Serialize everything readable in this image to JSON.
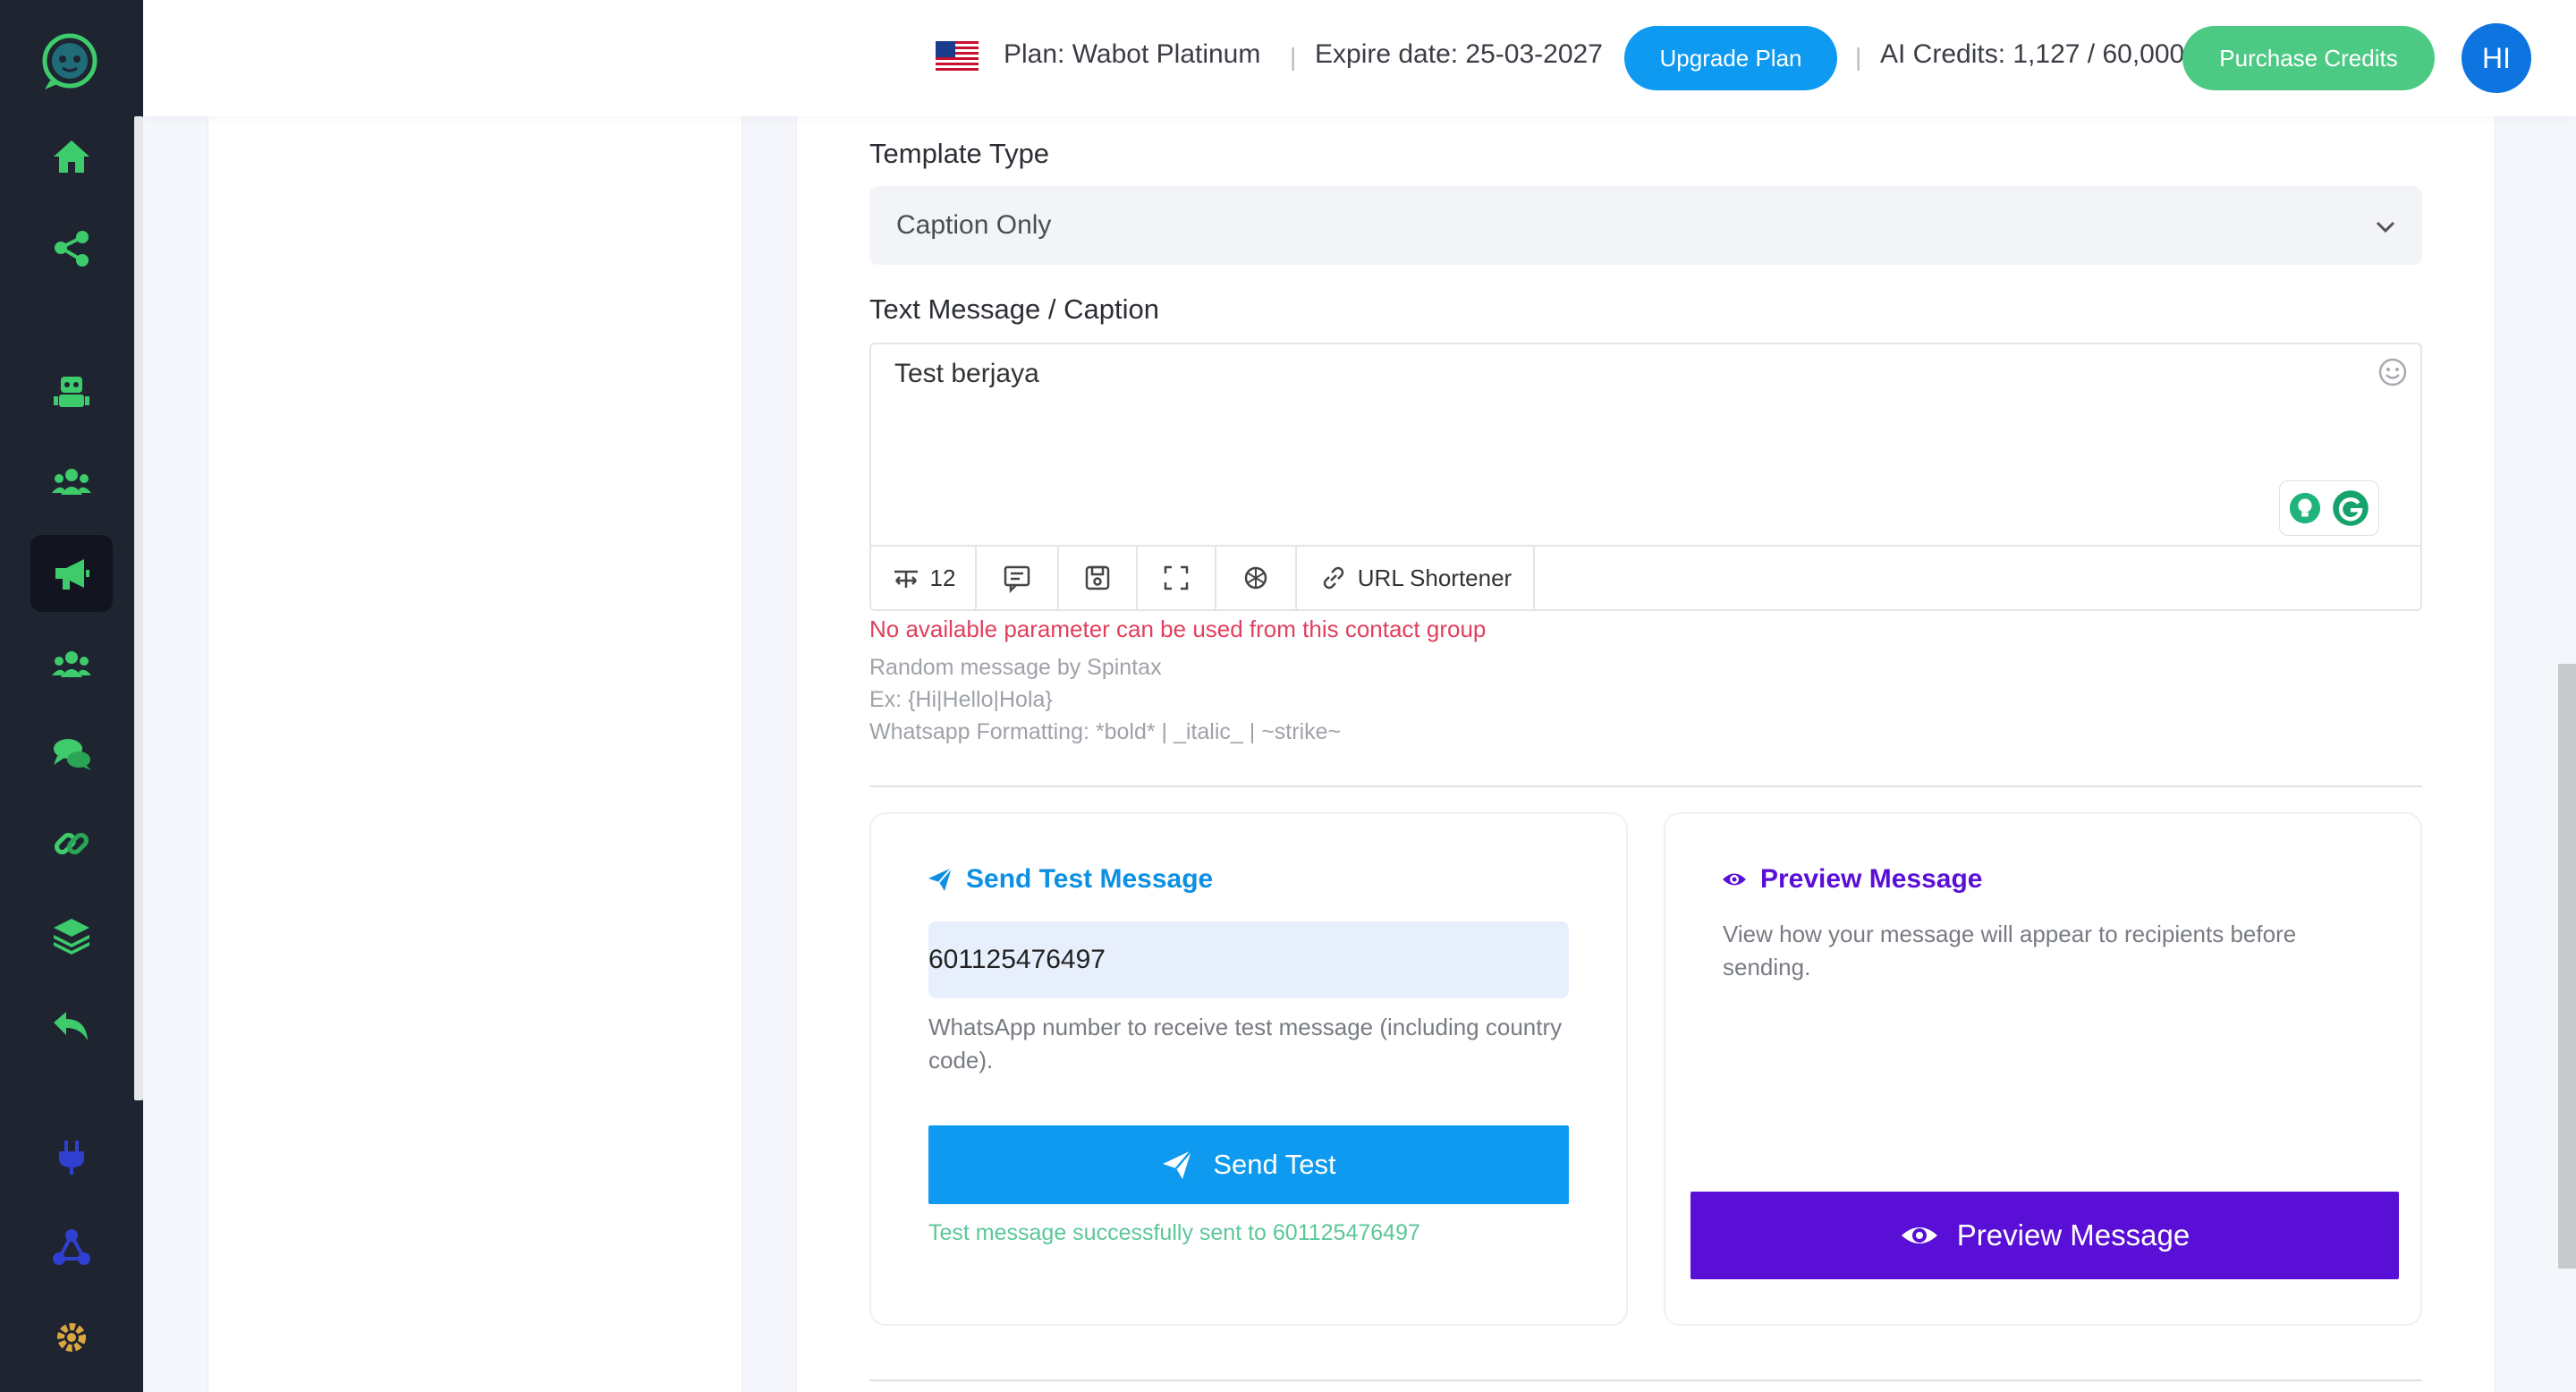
{
  "header": {
    "plan_label": "Plan: Wabot Platinum",
    "expire_label": "Expire date: 25-03-2027",
    "upgrade_button": "Upgrade Plan",
    "credits_label": "AI Credits: 1,127 / 60,000",
    "purchase_button": "Purchase Credits",
    "avatar_initials": "HI",
    "separator": "|"
  },
  "sidebar": {
    "items": [
      {
        "name": "home-icon",
        "color": "#3ecb6b"
      },
      {
        "name": "share-icon",
        "color": "#3ecb6b"
      },
      {
        "name": "robot-icon",
        "color": "#3ecb6b"
      },
      {
        "name": "users-icon",
        "color": "#3ecb6b"
      },
      {
        "name": "megaphone-icon",
        "color": "#3ecb6b"
      },
      {
        "name": "contacts-icon",
        "color": "#3ecb6b"
      },
      {
        "name": "chat-icon",
        "color": "#3ecb6b"
      },
      {
        "name": "link-icon",
        "color": "#3ecb6b"
      },
      {
        "name": "layers-icon",
        "color": "#3ecb6b"
      },
      {
        "name": "reply-icon",
        "color": "#3ecb6b"
      },
      {
        "name": "plug-icon",
        "color": "#2f3fd0"
      },
      {
        "name": "network-icon",
        "color": "#2f3fd0"
      },
      {
        "name": "gear-icon",
        "color": "#d9a640"
      }
    ]
  },
  "form": {
    "template_type_label": "Template Type",
    "template_type_value": "Caption Only",
    "caption_label": "Text Message / Caption",
    "caption_value": "Test berjaya",
    "toolbar": {
      "counter": "12",
      "url_shortener": "URL Shortener"
    },
    "error_text": "No available parameter can be used from this contact group",
    "hints": [
      "Random message by Spintax",
      "Ex: {Hi|Hello|Hola}",
      "Whatsapp Formatting: *bold* | _italic_ | ~strike~"
    ]
  },
  "send_test": {
    "title": "Send Test Message",
    "phone_value": "601125476497",
    "help_text": "WhatsApp number to receive test message (including country code).",
    "button_label": "Send Test",
    "success_text": "Test message successfully sent to 601125476497"
  },
  "preview": {
    "title": "Preview Message",
    "description": "View how your message will appear to recipients before sending.",
    "button_label": "Preview Message"
  },
  "colors": {
    "sidebar_bg": "#1f2431",
    "primary_blue": "#0d9af0",
    "success_green": "#4cca84",
    "preview_purple": "#5a0fd6",
    "error_red": "#e0405e"
  }
}
